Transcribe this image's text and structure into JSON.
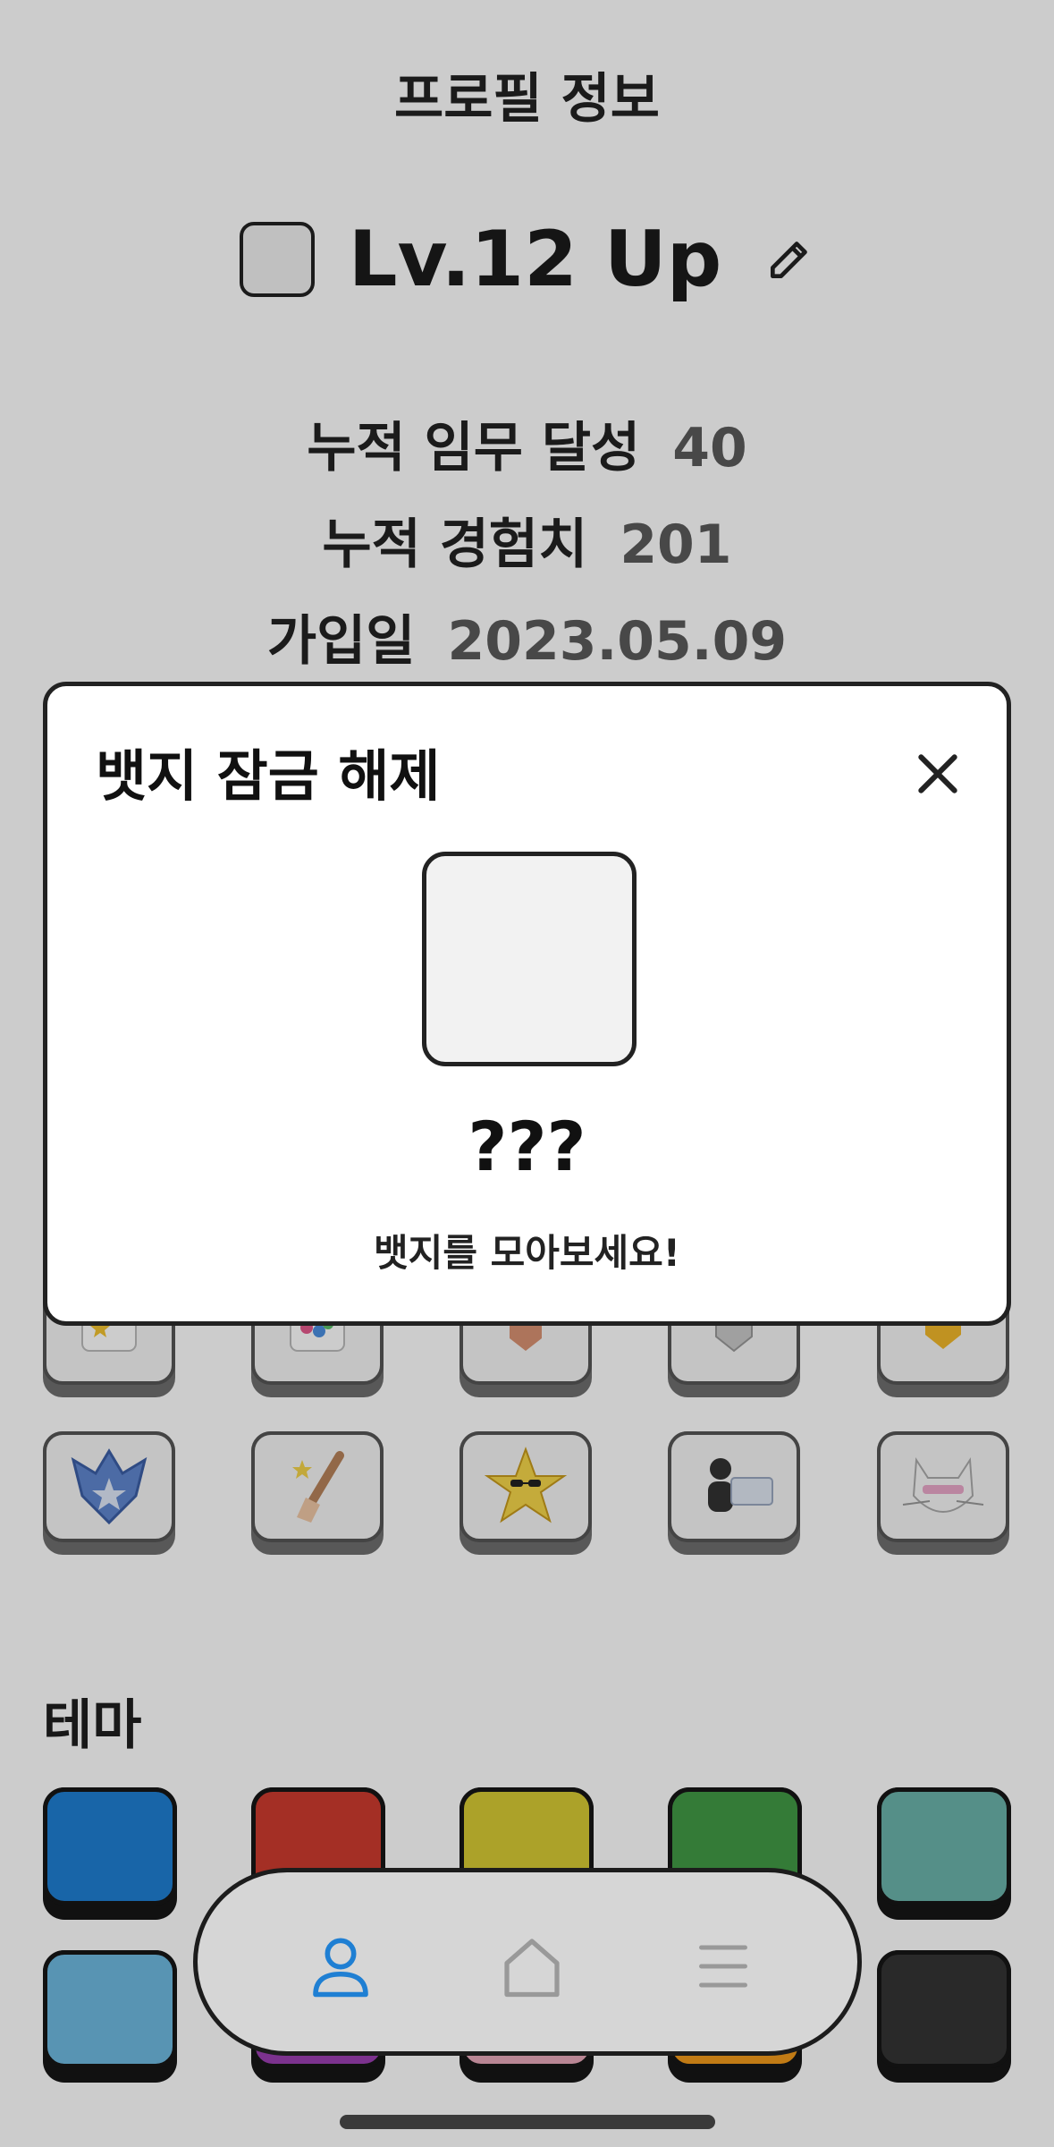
{
  "page_title": "프로필 정보",
  "profile": {
    "level_label": "Lv.12 Up"
  },
  "stats": [
    {
      "label": "누적 임무 달성",
      "value": "40"
    },
    {
      "label": "누적 경험치",
      "value": "201"
    },
    {
      "label": "가입일",
      "value": "2023.05.09"
    }
  ],
  "badges": [
    {
      "icon": "star-jar-icon"
    },
    {
      "icon": "colorful-star-jar-icon"
    },
    {
      "icon": "bronze-medal-icon"
    },
    {
      "icon": "silver-medal-icon"
    },
    {
      "icon": "gold-medal-icon"
    },
    {
      "icon": "wolf-star-icon"
    },
    {
      "icon": "sparkle-brush-icon"
    },
    {
      "icon": "sunglasses-star-icon"
    },
    {
      "icon": "worker-laptop-icon"
    },
    {
      "icon": "cool-cat-icon"
    }
  ],
  "theme": {
    "title": "테마",
    "colors": [
      "#1f7fd3",
      "#ce3b2f",
      "#d8cb34",
      "#429a45",
      "#6bb3aa",
      "#6fb9e0",
      "#9b3fb2",
      "#e8a8b9",
      "#f29a1b",
      "#343434"
    ]
  },
  "modal": {
    "title": "뱃지 잠금 해제",
    "badge_name": "???",
    "hint": "뱃지를 모아보세요!"
  },
  "tabbar": {
    "items": [
      {
        "icon": "person-icon",
        "active": true
      },
      {
        "icon": "home-icon",
        "active": false
      },
      {
        "icon": "menu-icon",
        "active": false
      }
    ],
    "accent_color": "#1f7fd3"
  }
}
